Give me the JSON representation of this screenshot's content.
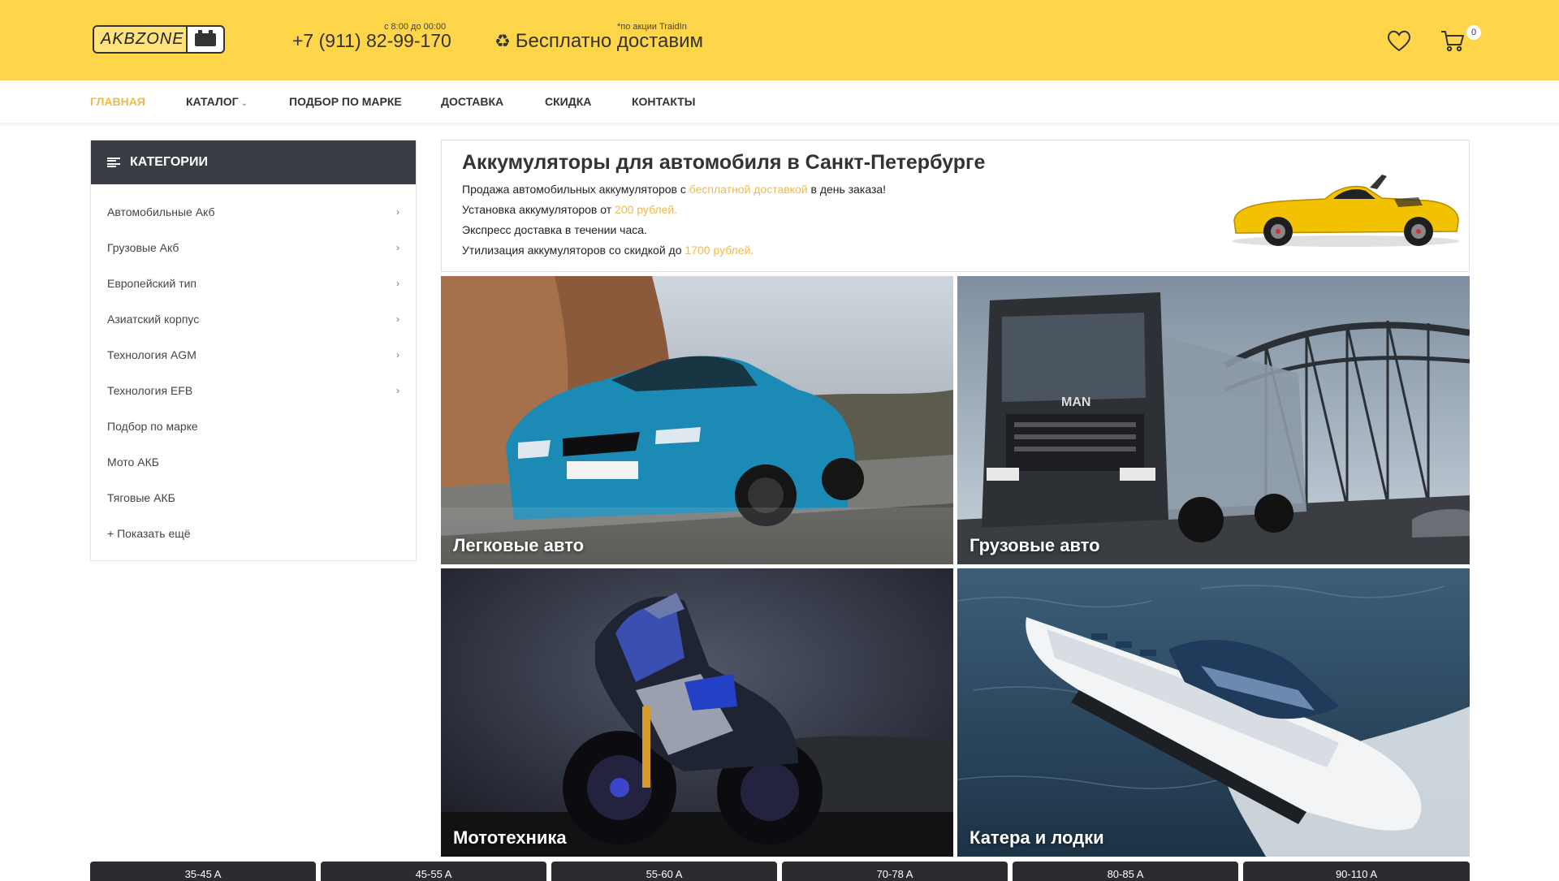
{
  "header": {
    "logo_text": "AKBZONE",
    "phone_hours": "с 8:00 до 00:00",
    "phone": "+7 (911) 82-99-170",
    "delivery_note": "*по акции TraidIn",
    "delivery_icon": "♻",
    "delivery_text": "Бесплатно доставим",
    "cart_count": "0",
    "icons": [
      "heart-icon",
      "cart-icon",
      "recycle-icon"
    ],
    "accent_color": "#ffd54a"
  },
  "nav": {
    "items": [
      {
        "label": "ГЛАВНАЯ",
        "active": true
      },
      {
        "label": "КАТАЛОГ",
        "caret": "⌄"
      },
      {
        "label": "ПОДБОР ПО МАРКЕ"
      },
      {
        "label": "ДОСТАВКА"
      },
      {
        "label": "СКИДКА"
      },
      {
        "label": "КОНТАКТЫ"
      }
    ],
    "active_color": "#f2b84b"
  },
  "sidebar": {
    "title": "КАТЕГОРИИ",
    "items": [
      {
        "label": "Автомобильные Акб",
        "chevron": "›"
      },
      {
        "label": "Грузовые Акб",
        "chevron": "›"
      },
      {
        "label": "Европейский тип",
        "chevron": "›"
      },
      {
        "label": "Азиатский корпус",
        "chevron": "›"
      },
      {
        "label": "Технология AGM",
        "chevron": "›"
      },
      {
        "label": "Технология EFB",
        "chevron": "›"
      },
      {
        "label": "Подбор по марке"
      },
      {
        "label": "Мото АКБ"
      },
      {
        "label": "Тяговые АКБ"
      },
      {
        "label": "+ Показать ещё"
      }
    ]
  },
  "intro": {
    "title": "Аккумуляторы для автомобиля в Санкт-Петербурге",
    "line1_a": "Продажа автомобильных аккумуляторов с ",
    "line1_hl": "бесплатной доставкой",
    "line1_b": " в день заказа!",
    "line2_a": "Установка аккумуляторов от ",
    "line2_hl": "200 рублей.",
    "line3": "Экспресс доставка в течении часа.",
    "line4_a": "Утилизация аккумуляторов со скидкой до ",
    "line4_hl": "1700 рублей."
  },
  "tiles": [
    {
      "label": "Легковые авто"
    },
    {
      "label": "Грузовые авто"
    },
    {
      "label": "Мототехника"
    },
    {
      "label": "Катера и лодки"
    }
  ],
  "bottom_tabs": [
    "35-45 A",
    "45-55 A",
    "55-60 A",
    "70-78 A",
    "80-85 A",
    "90-110 A"
  ]
}
